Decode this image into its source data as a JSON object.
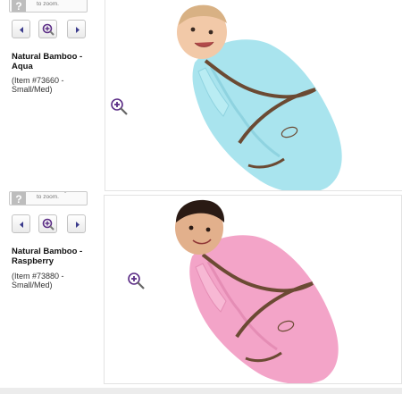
{
  "products": [
    {
      "hint_text": "Select image. Click to zoom.",
      "name": "Natural Bamboo - Aqua",
      "item": "(Item #73660 - Small/Med)",
      "swaddle_color": "#a9e4ee",
      "swaddle_shade": "#8fd3e0",
      "trim_color": "#6b4a33"
    },
    {
      "hint_text": "Select image. Click to zoom.",
      "name": "Natural Bamboo - Raspberry",
      "item": "(Item #73880 - Small/Med)",
      "swaddle_color": "#f3a4c8",
      "swaddle_shade": "#e58db5",
      "trim_color": "#6b4a33"
    }
  ],
  "colors": {
    "accent_purple": "#5b2c86",
    "button_arrow": "#3a3a8c"
  },
  "icons": {
    "prev": "triangle-left-icon",
    "zoom": "magnifier-plus-icon",
    "next": "triangle-right-icon",
    "zoom_cursor": "zoom-in-cursor-icon",
    "hint": "question-mark-icon"
  }
}
